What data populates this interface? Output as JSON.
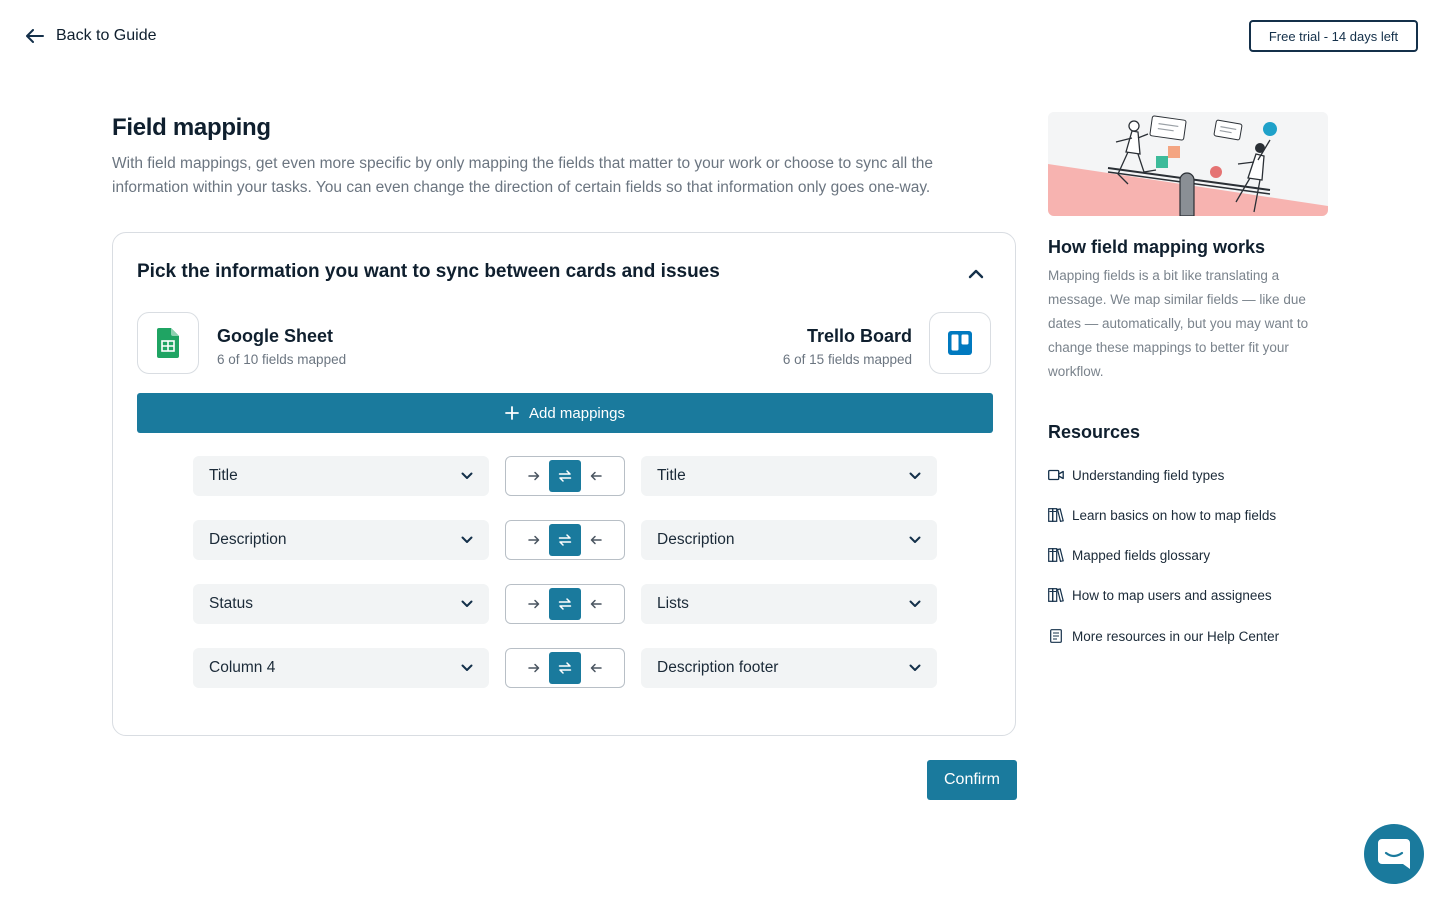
{
  "header": {
    "back_label": "Back to Guide",
    "trial_label": "Free trial - 14 days left"
  },
  "intro": {
    "title": "Field mapping",
    "description": "With field mappings, get even more specific by only mapping the fields that matter to your work or choose to sync all the information within your tasks. You can even change the direction of certain fields so that information only goes one-way."
  },
  "card": {
    "title": "Pick the information you want to sync between cards and issues",
    "left_app": {
      "name": "Google Sheet",
      "sub": "6 of 10 fields mapped",
      "icon": "google-sheets-icon"
    },
    "right_app": {
      "name": "Trello Board",
      "sub": "6 of 15 fields mapped",
      "icon": "trello-icon"
    },
    "add_label": "Add mappings",
    "mappings": [
      {
        "left": "Title",
        "right": "Title",
        "direction": "both"
      },
      {
        "left": "Description",
        "right": "Description",
        "direction": "both"
      },
      {
        "left": "Status",
        "right": "Lists",
        "direction": "both"
      },
      {
        "left": "Column 4",
        "right": "Description footer",
        "direction": "both"
      }
    ]
  },
  "confirm_label": "Confirm",
  "sidebar": {
    "title": "How field mapping works",
    "description": "Mapping fields is a bit like translating a message. We map similar fields — like due dates — automatically, but you may want to change these mappings to better fit your workflow.",
    "resources_title": "Resources",
    "resources": [
      {
        "label": "Understanding field types",
        "icon": "video-icon"
      },
      {
        "label": "Learn basics on how to map fields",
        "icon": "library-icon"
      },
      {
        "label": "Mapped fields glossary",
        "icon": "library-icon"
      },
      {
        "label": "How to map users and assignees",
        "icon": "library-icon"
      },
      {
        "label": "More resources in our Help Center",
        "icon": "document-icon"
      }
    ]
  },
  "colors": {
    "accent": "#1a7a9d",
    "sheets_green": "#1fa463",
    "trello_blue": "#0079bf",
    "illustration_pink": "#f7b3b0"
  }
}
